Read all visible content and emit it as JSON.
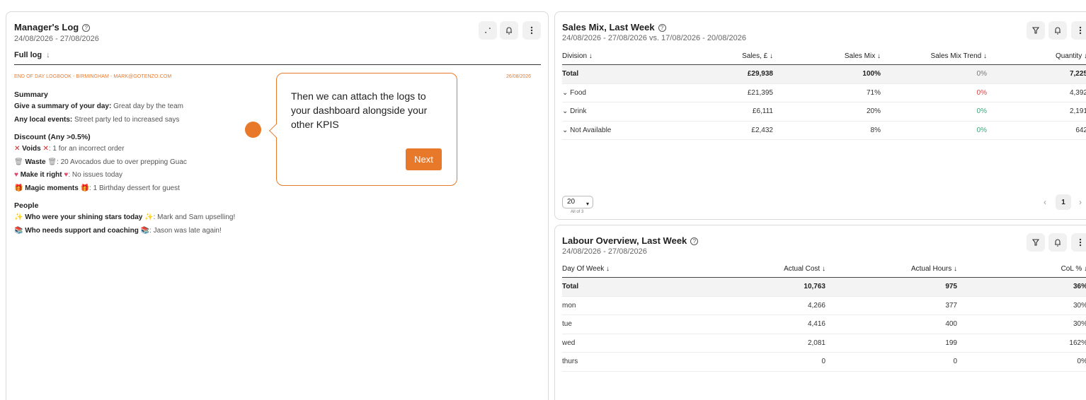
{
  "managers_log": {
    "title": "Manager's Log",
    "help_icon": "?",
    "date_range": "24/08/2026 - 27/08/2026",
    "filter_label": "Full log",
    "filter_arrow": "↓",
    "entry_meta": "END OF DAY LOGBOOK - BIRMINGHAM - MARK@GOTENZO.COM",
    "entry_date": "26/08/2026",
    "sections": {
      "summary": {
        "heading": "Summary",
        "q1": "Give a summary of your day:",
        "a1": "Great day by the team",
        "q2": "Any local events:",
        "a2": "Street party led to increased says"
      },
      "discount": {
        "heading": "Discount (Any >0.5%)",
        "voids_label": "Voids",
        "voids_value": ": 1 for an incorrect order",
        "voids_emoji": "✕",
        "waste_label": "Waste",
        "waste_value": ": 20 Avocados due to over prepping Guac",
        "waste_emoji": "🗑",
        "make_right_label": "Make it right",
        "make_right_value": ": No issues today",
        "make_right_emoji": "♥",
        "magic_label": "Magic moments",
        "magic_value": ": 1 Birthday dessert for guest",
        "magic_emoji": "🎁"
      },
      "people": {
        "heading": "People",
        "stars_label": "Who were your shining stars today",
        "stars_value": ": Mark and Sam upselling!",
        "stars_emoji": "✨",
        "support_label": "Who needs support and coaching",
        "support_value": ": Jason was late again!",
        "support_emoji": "📚"
      }
    }
  },
  "tooltip": {
    "text": "Then we can attach the logs to your dashboard alongside your other KPIS",
    "next_label": "Next"
  },
  "sales_mix": {
    "title": "Sales Mix, Last Week",
    "help_icon": "?",
    "date_range": "24/08/2026 - 27/08/2026 vs. 17/08/2026 - 20/08/2026",
    "columns": [
      "Division ↓",
      "Sales, £ ↓",
      "Sales Mix ↓",
      "Sales Mix Trend ↓",
      "Quantity ↓"
    ],
    "rows": [
      {
        "division": "Total",
        "sales": "£29,938",
        "mix": "100%",
        "trend": "0%",
        "qty": "7,225"
      },
      {
        "division": "⌄ Food",
        "sales": "£21,395",
        "mix": "71%",
        "trend": "0%",
        "qty": "4,392"
      },
      {
        "division": "⌄ Drink",
        "sales": "£6,111",
        "mix": "20%",
        "trend": "0%",
        "qty": "2,191"
      },
      {
        "division": "⌄ Not Available",
        "sales": "£2,432",
        "mix": "8%",
        "trend": "0%",
        "qty": "642"
      }
    ],
    "trend_colors": [
      "#777777",
      "#e04040",
      "#3aa57a",
      "#3aa57a"
    ],
    "page_size": "20",
    "page_count": "All of 3",
    "current_page": "1",
    "prev": "‹",
    "next": "›"
  },
  "labour": {
    "title": "Labour Overview, Last Week",
    "help_icon": "?",
    "date_range": "24/08/2026 - 27/08/2026",
    "columns": [
      "Day Of Week ↓",
      "Actual Cost ↓",
      "Actual Hours ↓",
      "CoL % ↓"
    ],
    "rows": [
      {
        "day": "Total",
        "cost": "10,763",
        "hours": "975",
        "col": "36%"
      },
      {
        "day": "mon",
        "cost": "4,266",
        "hours": "377",
        "col": "30%"
      },
      {
        "day": "tue",
        "cost": "4,416",
        "hours": "400",
        "col": "30%"
      },
      {
        "day": "wed",
        "cost": "2,081",
        "hours": "199",
        "col": "162%"
      },
      {
        "day": "thurs",
        "cost": "0",
        "hours": "0",
        "col": "0%"
      }
    ]
  },
  "colors": {
    "accent": "#e8792b",
    "negative": "#e04040",
    "positive": "#3aa57a"
  }
}
